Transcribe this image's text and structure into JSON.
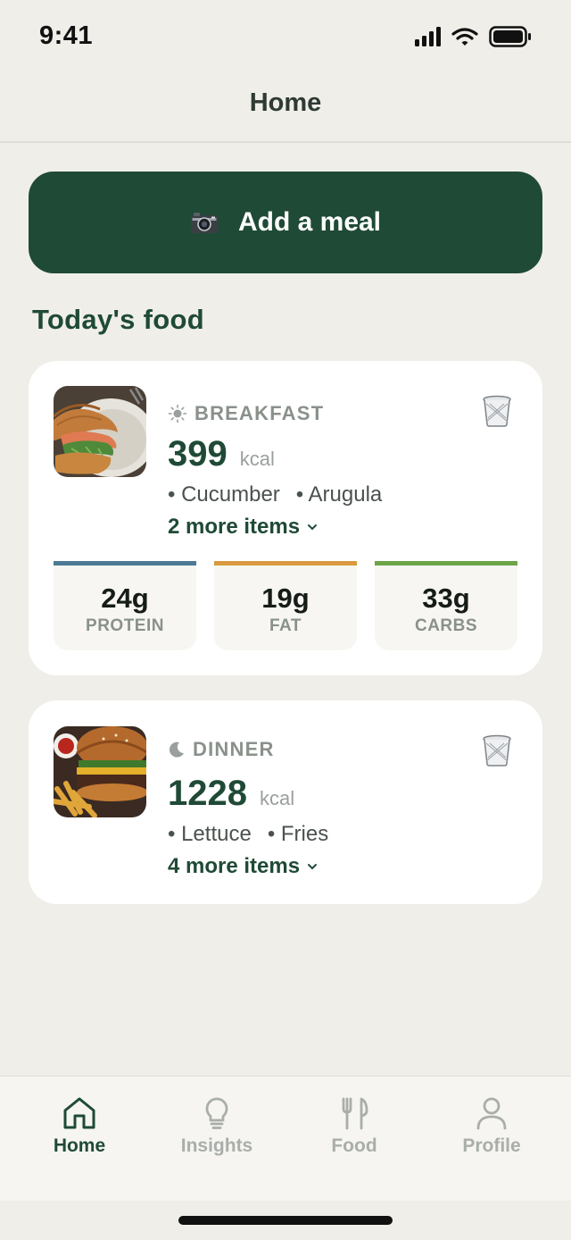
{
  "status_bar": {
    "time": "9:41"
  },
  "header": {
    "title": "Home"
  },
  "add_meal": {
    "label": "Add a meal",
    "icon": "camera-icon"
  },
  "section": {
    "title": "Today's food"
  },
  "meals": [
    {
      "type": "BREAKFAST",
      "type_icon": "sun-icon",
      "calories": "399",
      "unit": "kcal",
      "ingredients": [
        "Cucumber",
        "Arugula"
      ],
      "more": "2 more items",
      "macros": [
        {
          "value": "24g",
          "label": "PROTEIN",
          "color": "#4d7a95"
        },
        {
          "value": "19g",
          "label": "FAT",
          "color": "#d99a3e"
        },
        {
          "value": "33g",
          "label": "CARBS",
          "color": "#6ba548"
        }
      ]
    },
    {
      "type": "DINNER",
      "type_icon": "moon-icon",
      "calories": "1228",
      "unit": "kcal",
      "ingredients": [
        "Lettuce",
        "Fries"
      ],
      "more": "4 more items"
    }
  ],
  "tabs": [
    {
      "label": "Home",
      "icon": "home-icon",
      "active": true
    },
    {
      "label": "Insights",
      "icon": "lightbulb-icon",
      "active": false
    },
    {
      "label": "Food",
      "icon": "fork-knife-icon",
      "active": false
    },
    {
      "label": "Profile",
      "icon": "person-icon",
      "active": false
    }
  ],
  "colors": {
    "accent": "#1f4a36",
    "background": "#f0eee8",
    "card": "#ffffff",
    "tab_inactive": "#a9aeaa"
  }
}
